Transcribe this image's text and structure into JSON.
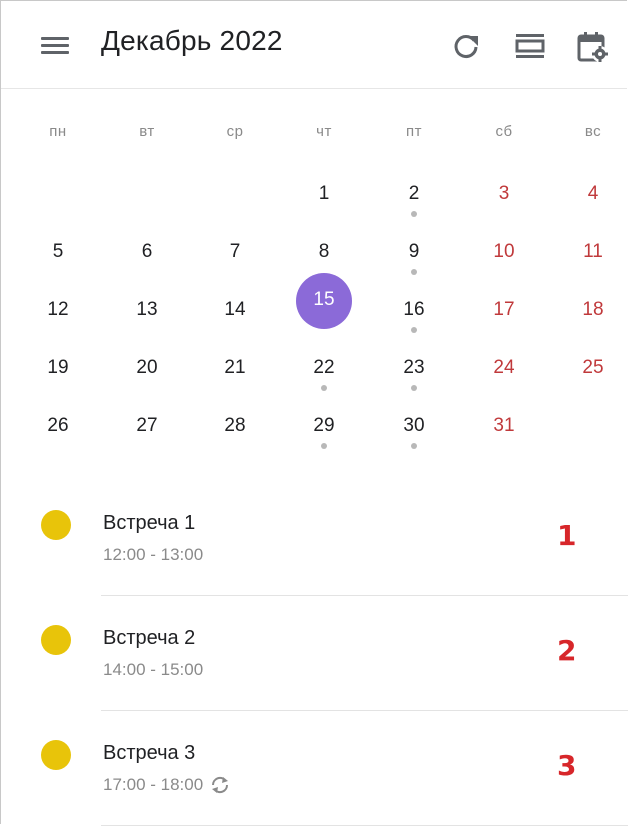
{
  "header": {
    "title": "Декабрь 2022",
    "menu_icon": "menu-icon",
    "actions": [
      "refresh-icon",
      "view-toggle-icon",
      "calendar-settings-icon"
    ]
  },
  "weekdays": [
    "пн",
    "вт",
    "ср",
    "чт",
    "пт",
    "сб",
    "вс"
  ],
  "calendar": {
    "selected_day": "15",
    "accent_color": "#8b6ad8",
    "weekend_color": "#c0393b",
    "weeks": [
      [
        null,
        null,
        null,
        {
          "d": "1"
        },
        {
          "d": "2",
          "dot": true
        },
        {
          "d": "3"
        },
        {
          "d": "4"
        }
      ],
      [
        {
          "d": "5"
        },
        {
          "d": "6"
        },
        {
          "d": "7"
        },
        {
          "d": "8"
        },
        {
          "d": "9",
          "dot": true
        },
        {
          "d": "10"
        },
        {
          "d": "11"
        }
      ],
      [
        {
          "d": "12"
        },
        {
          "d": "13"
        },
        {
          "d": "14"
        },
        {
          "d": "15"
        },
        {
          "d": "16",
          "dot": true
        },
        {
          "d": "17"
        },
        {
          "d": "18"
        }
      ],
      [
        {
          "d": "19"
        },
        {
          "d": "20"
        },
        {
          "d": "21"
        },
        {
          "d": "22",
          "dot": true
        },
        {
          "d": "23",
          "dot": true
        },
        {
          "d": "24"
        },
        {
          "d": "25"
        }
      ],
      [
        {
          "d": "26"
        },
        {
          "d": "27"
        },
        {
          "d": "28"
        },
        {
          "d": "29",
          "dot": true
        },
        {
          "d": "30",
          "dot": true
        },
        {
          "d": "31"
        },
        null
      ]
    ]
  },
  "events": [
    {
      "title": "Встреча 1",
      "time": "12:00 - 13:00",
      "repeat": false,
      "marker": "1",
      "color": "#e8c40a"
    },
    {
      "title": "Встреча 2",
      "time": "14:00 - 15:00",
      "repeat": false,
      "marker": "2",
      "color": "#e8c40a"
    },
    {
      "title": "Встреча 3",
      "time": "17:00 - 18:00",
      "repeat": true,
      "marker": "3",
      "color": "#e8c40a"
    }
  ]
}
